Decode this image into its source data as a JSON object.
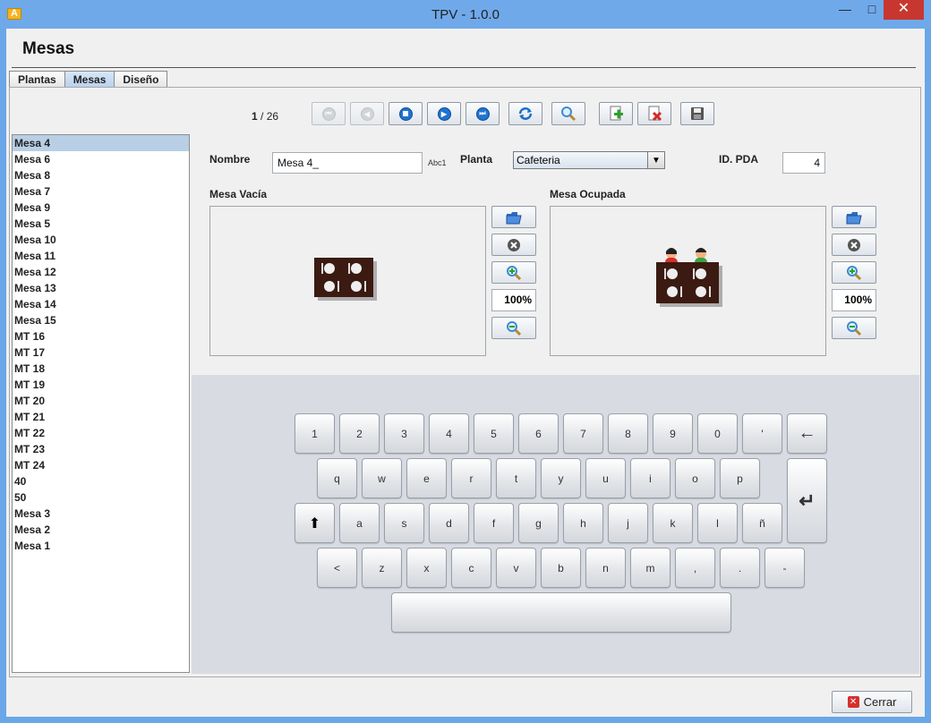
{
  "window": {
    "title": "TPV - 1.0.0",
    "app_icon_letter": "A",
    "min": "—",
    "max": "□",
    "close": "✕"
  },
  "page": {
    "title": "Mesas"
  },
  "tabs": [
    {
      "label": "Plantas"
    },
    {
      "label": "Mesas"
    },
    {
      "label": "Diseño"
    }
  ],
  "nav": {
    "current": "1",
    "separator": "/",
    "total": "26"
  },
  "list": {
    "items": [
      "Mesa 4",
      "Mesa 6",
      "Mesa 8",
      "Mesa 7",
      "Mesa 9",
      "Mesa 5",
      "Mesa 10",
      "Mesa 11",
      "Mesa 12",
      "Mesa 13",
      "Mesa 14",
      "Mesa 15",
      "MT 16",
      "MT 17",
      "MT 18",
      "MT 19",
      "MT 20",
      "MT 21",
      "MT 22",
      "MT 23",
      "MT 24",
      "40",
      "50",
      "Mesa 3",
      "Mesa 2",
      "Mesa 1"
    ],
    "selected": "Mesa 4"
  },
  "form": {
    "nombre_label": "Nombre",
    "nombre_value": "Mesa 4_",
    "abc_hint": "Abc1",
    "planta_label": "Planta",
    "planta_value": "Cafeteria",
    "id_pda_label": "ID. PDA",
    "id_pda_value": "4",
    "mesa_vacia_label": "Mesa Vacía",
    "mesa_ocupada_label": "Mesa Ocupada",
    "zoom_vacia": "100%",
    "zoom_ocupada": "100%"
  },
  "keyboard": {
    "row1": [
      "1",
      "2",
      "3",
      "4",
      "5",
      "6",
      "7",
      "8",
      "9",
      "0",
      "'"
    ],
    "row2": [
      "q",
      "w",
      "e",
      "r",
      "t",
      "y",
      "u",
      "i",
      "o",
      "p"
    ],
    "row3": [
      "a",
      "s",
      "d",
      "f",
      "g",
      "h",
      "j",
      "k",
      "l",
      "ñ"
    ],
    "row4": [
      "<",
      "z",
      "x",
      "c",
      "v",
      "b",
      "n",
      "m",
      ",",
      ".",
      "-"
    ],
    "backspace": "←",
    "enter": "↵",
    "shift": "⬆",
    "space": ""
  },
  "footer": {
    "close_label": "Cerrar",
    "close_icon": "✕"
  },
  "colors": {
    "accent": "#2073d0",
    "selected_row": "#b8cfe5",
    "table_wood": "#3b1a12"
  }
}
